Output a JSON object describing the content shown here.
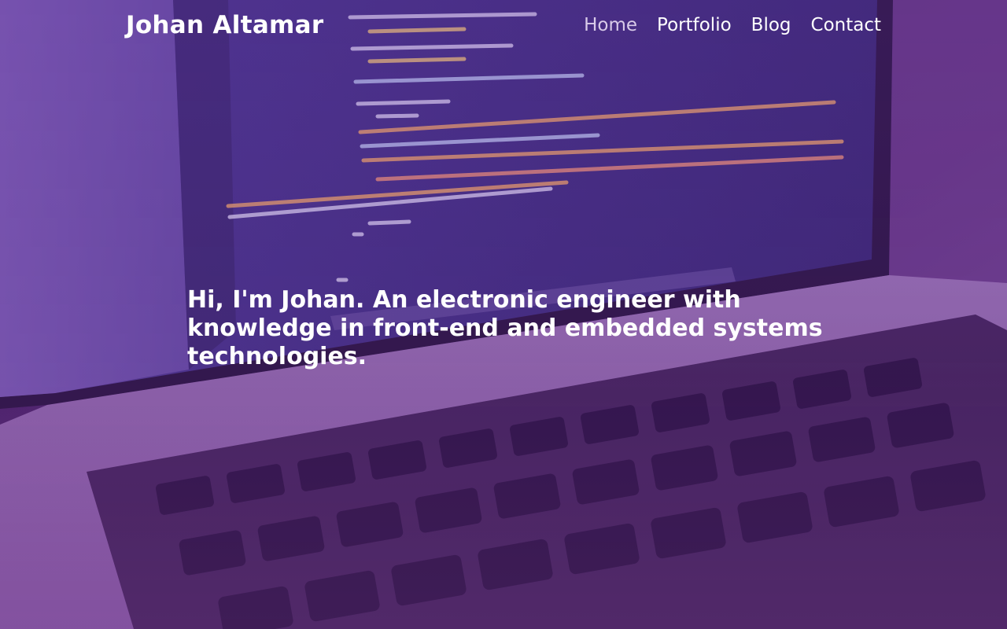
{
  "site": {
    "brand": "Johan Altamar"
  },
  "nav": {
    "items": [
      {
        "label": "Home",
        "active": true
      },
      {
        "label": "Portfolio",
        "active": false
      },
      {
        "label": "Blog",
        "active": false
      },
      {
        "label": "Contact",
        "active": false
      }
    ]
  },
  "hero": {
    "headline": "Hi, I'm Johan. An electronic engineer with knowledge in front-end and embedded systems technologies.",
    "background_image": "laptop-code-photo"
  },
  "colors": {
    "overlay": "#5a2b7a",
    "text": "#ffffff",
    "nav_active": "#d9cbe9"
  }
}
